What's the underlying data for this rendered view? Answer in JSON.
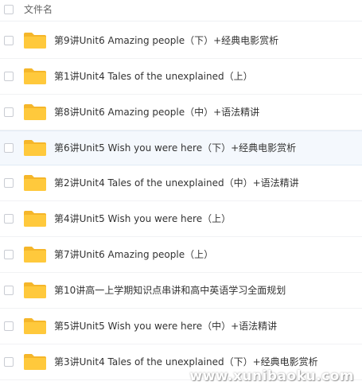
{
  "header": {
    "column_label": "文件名"
  },
  "files": [
    {
      "name": "第9讲Unit6 Amazing people（下）+经典电影赏析",
      "icon": "folder-icon"
    },
    {
      "name": "第1讲Unit4 Tales of the unexplained（上）",
      "icon": "folder-icon"
    },
    {
      "name": "第8讲Unit6 Amazing people（中）+语法精讲",
      "icon": "folder-icon"
    },
    {
      "name": "第6讲Unit5 Wish you were here（下）+经典电影赏析",
      "icon": "folder-icon"
    },
    {
      "name": "第2讲Unit4 Tales of the unexplained（中）+语法精讲",
      "icon": "folder-icon"
    },
    {
      "name": "第4讲Unit5 Wish you were here（上）",
      "icon": "folder-icon"
    },
    {
      "name": "第7讲Unit6 Amazing people（上）",
      "icon": "folder-icon"
    },
    {
      "name": "第10讲高一上学期知识点串讲和高中英语学习全面规划",
      "icon": "folder-icon"
    },
    {
      "name": "第5讲Unit5 Wish you were here（中）+语法精讲",
      "icon": "folder-icon"
    },
    {
      "name": "第3讲Unit4 Tales of the unexplained（下）+经典电影赏析",
      "icon": "folder-icon"
    }
  ],
  "watermark": "www.xunibaoku.com",
  "colors": {
    "folder_body": "#ffc93c",
    "folder_tab": "#f5b62a",
    "hover_row": "#f4f8fd"
  }
}
